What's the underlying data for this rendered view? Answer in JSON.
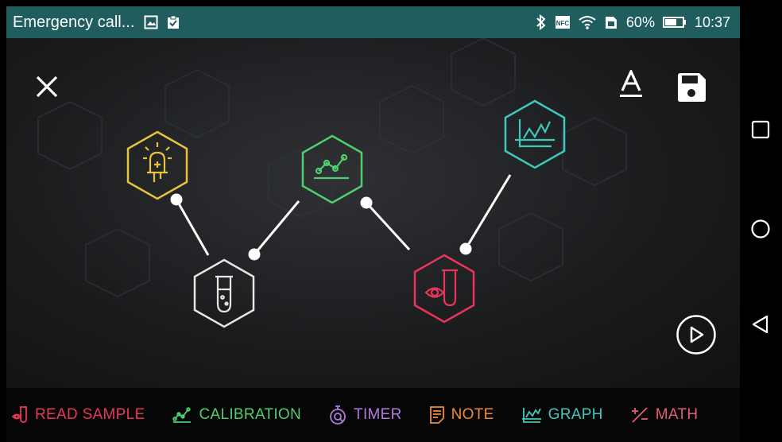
{
  "status_bar": {
    "title": "Emergency call...",
    "battery": "60%",
    "time": "10:37",
    "icons": [
      "image-icon",
      "clipboard-icon",
      "bluetooth-icon",
      "nfc-icon",
      "wifi-icon",
      "sim-icon",
      "battery-icon"
    ]
  },
  "toolbar": {
    "close_icon": "close-icon",
    "text_icon": "text-format-icon",
    "save_icon": "save-icon",
    "play_icon": "play-icon"
  },
  "nodes": [
    {
      "name": "sensor",
      "icon": "led-icon",
      "color": "#e8c43a"
    },
    {
      "name": "sample",
      "icon": "test-tube-icon",
      "color": "#e6e6e6"
    },
    {
      "name": "calibration",
      "icon": "calibration-icon",
      "color": "#4fcf6e"
    },
    {
      "name": "read-sample",
      "icon": "read-sample-icon",
      "color": "#e8365a"
    },
    {
      "name": "graph",
      "icon": "graph-icon",
      "color": "#3fc9bd"
    }
  ],
  "bottom_bar": {
    "items": [
      {
        "label": "READ SAMPLE",
        "icon": "read-sample-icon",
        "color": "#e8365a"
      },
      {
        "label": "CALIBRATION",
        "icon": "calibration-icon",
        "color": "#4fcf6e"
      },
      {
        "label": "TIMER",
        "icon": "timer-icon",
        "color": "#b17ae0"
      },
      {
        "label": "NOTE",
        "icon": "note-icon",
        "color": "#f08a3a"
      },
      {
        "label": "GRAPH",
        "icon": "graph-icon",
        "color": "#3fc9bd"
      },
      {
        "label": "MATH",
        "icon": "math-icon",
        "color": "#e85a7a"
      }
    ]
  },
  "nav_bar": {
    "icons": [
      "recents-icon",
      "home-icon",
      "back-icon"
    ]
  }
}
